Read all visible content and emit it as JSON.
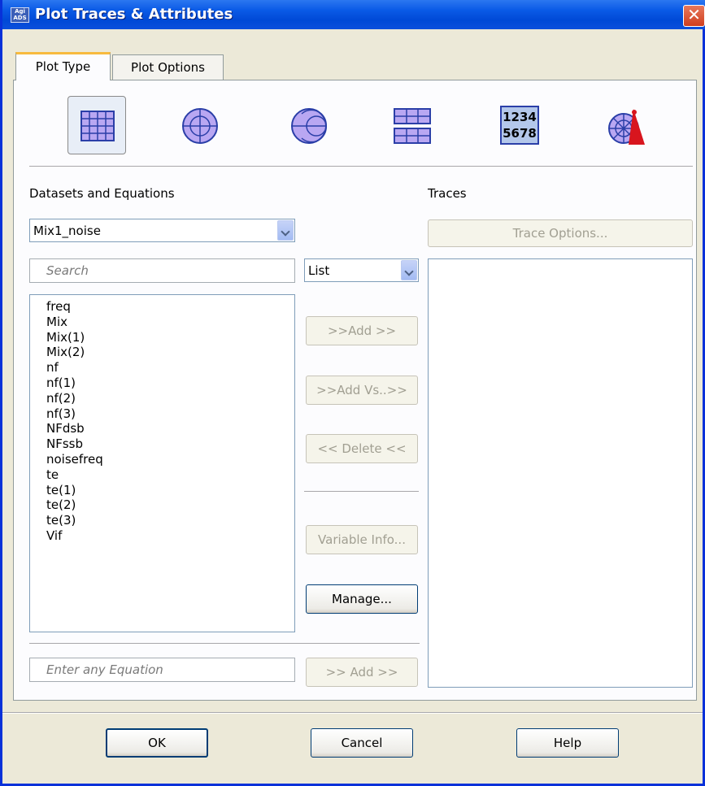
{
  "window": {
    "title": "Plot Traces & Attributes",
    "app_icon_text": "Agilent ADS"
  },
  "tabs": [
    {
      "label": "Plot Type",
      "active": true
    },
    {
      "label": "Plot Options",
      "active": false
    }
  ],
  "plot_types": [
    {
      "name": "rectangular-plot",
      "selected": true
    },
    {
      "name": "polar-plot",
      "selected": false
    },
    {
      "name": "smith-chart",
      "selected": false
    },
    {
      "name": "stacked-rectangular-plot",
      "selected": false
    },
    {
      "name": "list-table",
      "text_top": "1234",
      "text_bottom": "5678",
      "selected": false
    },
    {
      "name": "antenna-plot",
      "selected": false
    }
  ],
  "datasets": {
    "label": "Datasets and Equations",
    "selected": "Mix1_noise",
    "search_placeholder": "Search",
    "view_mode": "List",
    "variables": [
      "freq",
      "Mix",
      "Mix(1)",
      "Mix(2)",
      "nf",
      "nf(1)",
      "nf(2)",
      "nf(3)",
      "NFdsb",
      "NFssb",
      "noisefreq",
      "te",
      "te(1)",
      "te(2)",
      "te(3)",
      "Vif"
    ],
    "equation_placeholder": "Enter any Equation"
  },
  "middle_buttons": {
    "add": ">>Add >>",
    "add_vs": ">>Add Vs..>>",
    "delete": "<< Delete <<",
    "variable_info": "Variable Info...",
    "manage": "Manage...",
    "add_equation": ">> Add >>"
  },
  "traces": {
    "label": "Traces",
    "trace_options": "Trace Options..."
  },
  "footer": {
    "ok": "OK",
    "cancel": "Cancel",
    "help": "Help"
  }
}
